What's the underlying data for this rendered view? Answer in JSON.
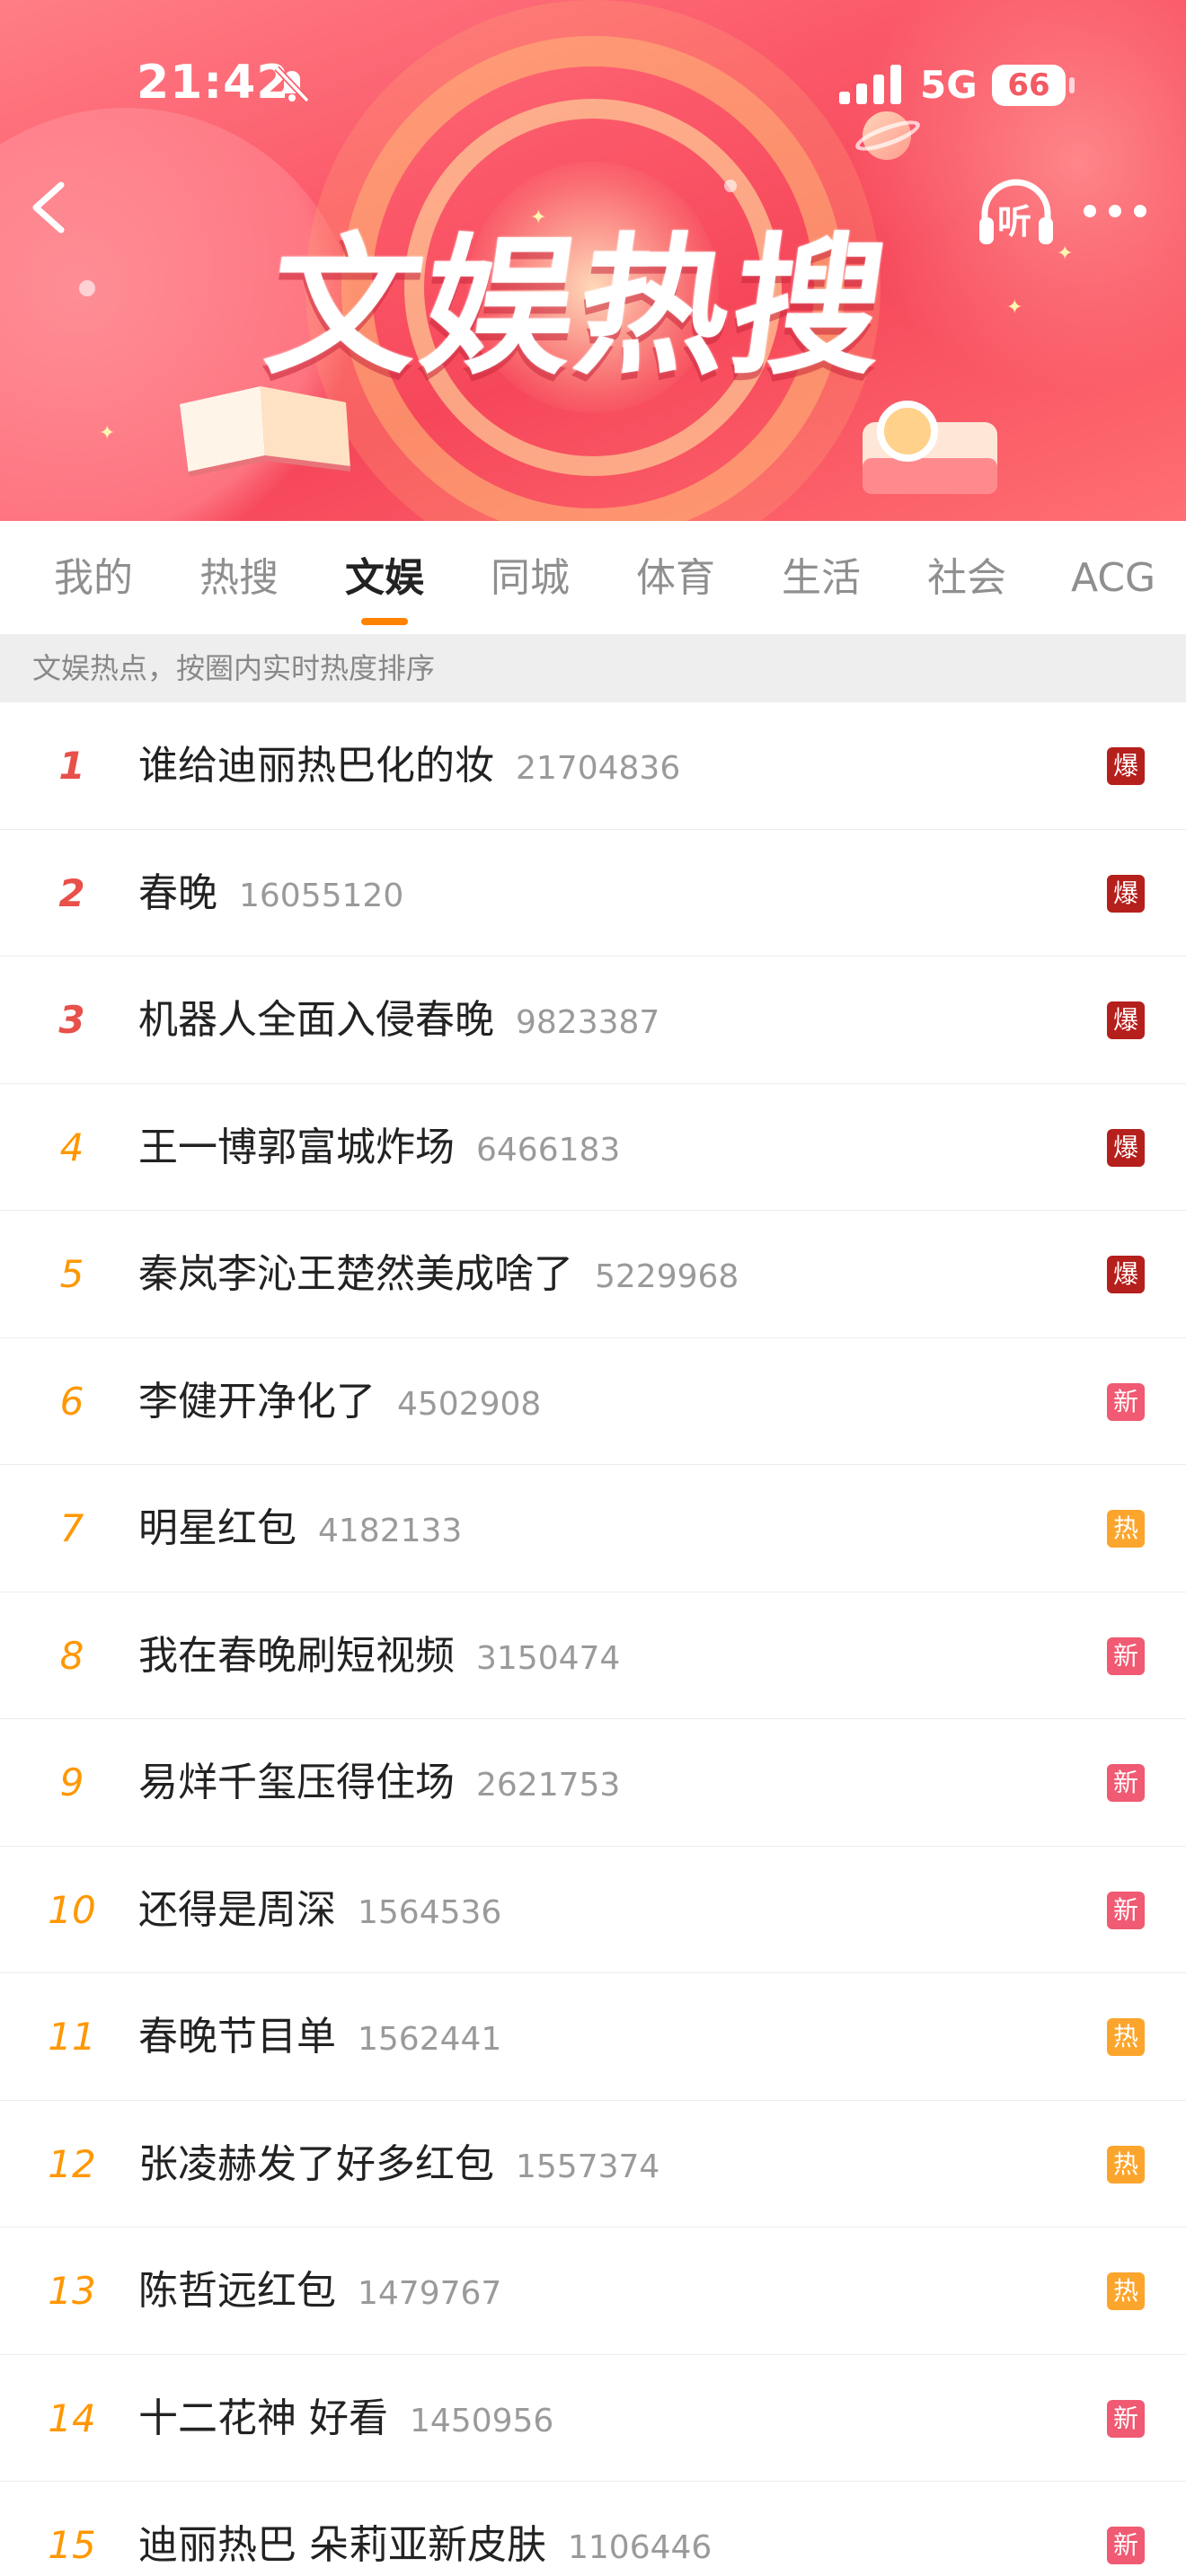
{
  "status_bar": {
    "time": "21:42",
    "network": "5G",
    "battery": "66"
  },
  "header": {
    "banner_title": "文娱热搜",
    "listen_label": "听"
  },
  "tabs": [
    {
      "label": "我的",
      "active": false
    },
    {
      "label": "热搜",
      "active": false
    },
    {
      "label": "文娱",
      "active": true
    },
    {
      "label": "同城",
      "active": false
    },
    {
      "label": "体育",
      "active": false
    },
    {
      "label": "生活",
      "active": false
    },
    {
      "label": "社会",
      "active": false
    },
    {
      "label": "ACG",
      "active": false
    }
  ],
  "notice": "文娱热点，按圈内实时热度排序",
  "badge_colors": {
    "爆": "#b51f1c",
    "新": "#f05a72",
    "热": "#fca52c"
  },
  "items": [
    {
      "rank": "1",
      "title": "谁给迪丽热巴化的妆",
      "count": "21704836",
      "badge": "爆"
    },
    {
      "rank": "2",
      "title": "春晚",
      "count": "16055120",
      "badge": "爆"
    },
    {
      "rank": "3",
      "title": "机器人全面入侵春晚",
      "count": "9823387",
      "badge": "爆"
    },
    {
      "rank": "4",
      "title": "王一博郭富城炸场",
      "count": "6466183",
      "badge": "爆"
    },
    {
      "rank": "5",
      "title": "秦岚李沁王楚然美成啥了",
      "count": "5229968",
      "badge": "爆"
    },
    {
      "rank": "6",
      "title": "李健开净化了",
      "count": "4502908",
      "badge": "新"
    },
    {
      "rank": "7",
      "title": "明星红包",
      "count": "4182133",
      "badge": "热"
    },
    {
      "rank": "8",
      "title": "我在春晚刷短视频",
      "count": "3150474",
      "badge": "新"
    },
    {
      "rank": "9",
      "title": "易烊千玺压得住场",
      "count": "2621753",
      "badge": "新"
    },
    {
      "rank": "10",
      "title": "还得是周深",
      "count": "1564536",
      "badge": "新"
    },
    {
      "rank": "11",
      "title": "春晚节目单",
      "count": "1562441",
      "badge": "热"
    },
    {
      "rank": "12",
      "title": "张凌赫发了好多红包",
      "count": "1557374",
      "badge": "热"
    },
    {
      "rank": "13",
      "title": "陈哲远红包",
      "count": "1479767",
      "badge": "热"
    },
    {
      "rank": "14",
      "title": "十二花神 好看",
      "count": "1450956",
      "badge": "新"
    },
    {
      "rank": "15",
      "title": "迪丽热巴 朵莉亚新皮肤",
      "count": "1106446",
      "badge": "新"
    }
  ]
}
